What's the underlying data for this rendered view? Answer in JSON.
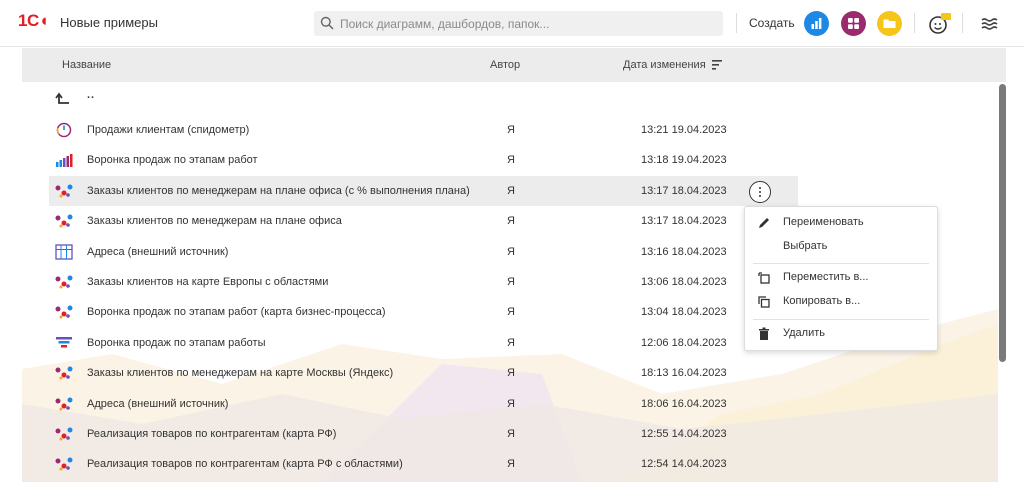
{
  "app": {
    "logo": "1С",
    "title": "Новые примеры"
  },
  "search": {
    "placeholder": "Поиск диаграмм, дашбордов, папок..."
  },
  "toolbar": {
    "create_label": "Создать"
  },
  "columns": {
    "name": "Название",
    "author": "Автор",
    "modified": "Дата изменения"
  },
  "parent_row": {
    "label": ".."
  },
  "rows": [
    {
      "name": "Продажи клиентам (спидометр)",
      "author": "Я",
      "date": "13:21 19.04.2023",
      "icon": "speedometer-icon"
    },
    {
      "name": "Воронка продаж по этапам работ",
      "author": "Я",
      "date": "13:18 19.04.2023",
      "icon": "bar-chart-icon"
    },
    {
      "name": "Заказы клиентов по менеджерам на плане офиса (с % выполнения плана)",
      "author": "Я",
      "date": "13:17 18.04.2023",
      "icon": "map-icon"
    },
    {
      "name": "Заказы клиентов по менеджерам на плане офиса",
      "author": "Я",
      "date": "13:17 18.04.2023",
      "icon": "map-icon"
    },
    {
      "name": "Адреса (внешний источник)",
      "author": "Я",
      "date": "13:16 18.04.2023",
      "icon": "table-icon"
    },
    {
      "name": "Заказы клиентов на карте Европы с областями",
      "author": "Я",
      "date": "13:06 18.04.2023",
      "icon": "map-icon"
    },
    {
      "name": "Воронка продаж по этапам работ (карта бизнес-процесса)",
      "author": "Я",
      "date": "13:04 18.04.2023",
      "icon": "map-icon"
    },
    {
      "name": "Воронка продаж по этапам работы",
      "author": "Я",
      "date": "12:06 18.04.2023",
      "icon": "funnel-icon"
    },
    {
      "name": "Заказы клиентов по менеджерам на карте Москвы (Яндекс)",
      "author": "Я",
      "date": "18:13 16.04.2023",
      "icon": "map-icon"
    },
    {
      "name": "Адреса (внешний источник)",
      "author": "Я",
      "date": "18:06 16.04.2023",
      "icon": "map-icon"
    },
    {
      "name": "Реализация товаров по контрагентам (карта РФ)",
      "author": "Я",
      "date": "12:55 14.04.2023",
      "icon": "map-icon"
    },
    {
      "name": "Реализация товаров по контрагентам (карта РФ  с областями)",
      "author": "Я",
      "date": "12:54 14.04.2023",
      "icon": "map-icon"
    }
  ],
  "context_menu": {
    "rename": "Переименовать",
    "select": "Выбрать",
    "move": "Переместить в...",
    "copy": "Копировать в...",
    "delete": "Удалить"
  },
  "colors": {
    "brand": "#e31e24",
    "blue": "#1e88e5",
    "purple": "#9c2a6e",
    "yellow": "#f5c518"
  }
}
